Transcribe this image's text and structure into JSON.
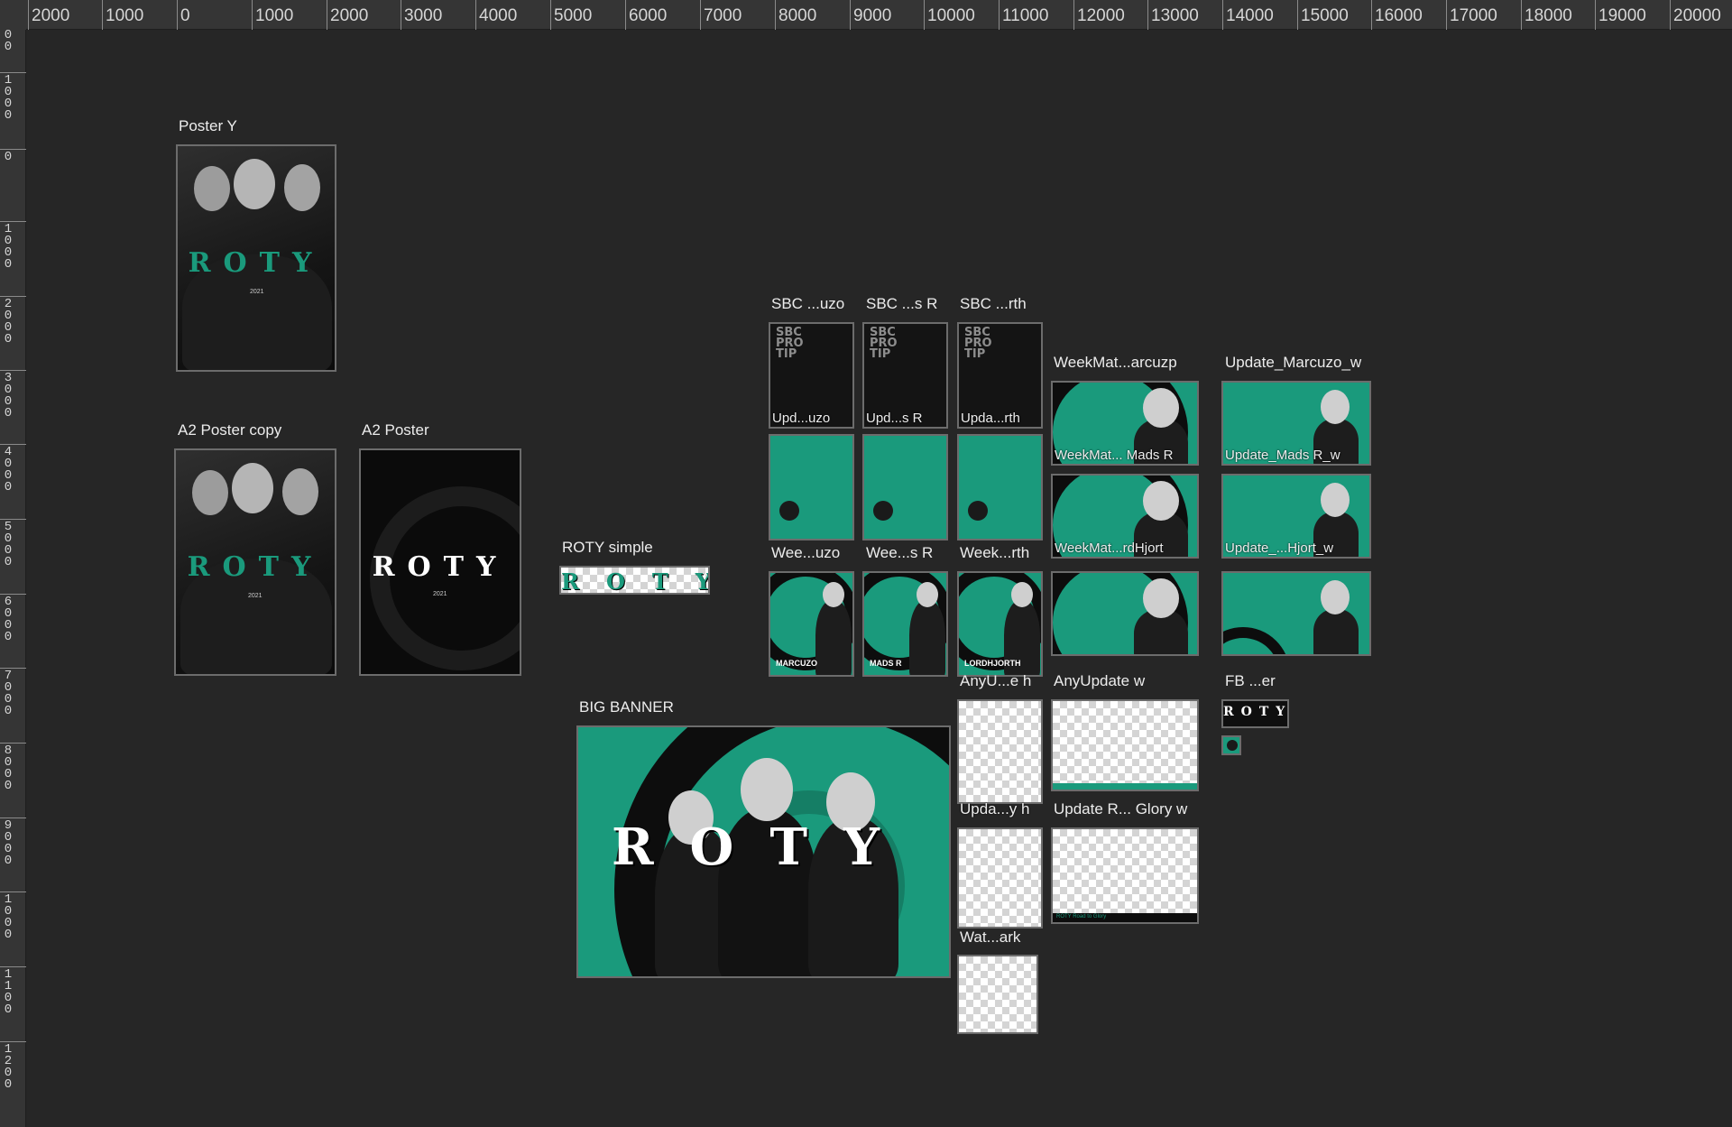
{
  "ruler": {
    "top_ticks": [
      "2000",
      "1000",
      "0",
      "1000",
      "2000",
      "3000",
      "4000",
      "5000",
      "6000",
      "7000",
      "8000",
      "9000",
      "10000",
      "11000",
      "12000",
      "13000",
      "14000",
      "15000",
      "16000",
      "17000",
      "18000",
      "19000",
      "20000"
    ],
    "left_ticks": [
      "0\n0",
      "1\n0\n0\n0",
      "0",
      "1\n0\n0\n0",
      "2\n0\n0\n0",
      "3\n0\n0\n0",
      "4\n0\n0\n0",
      "5\n0\n0\n0",
      "6\n0\n0\n0",
      "7\n0\n0\n0",
      "8\n0\n0\n0",
      "9\n0\n0\n0",
      "1\n0\n0\n0",
      "1\n1\n0\n0",
      "1\n2\n0\n0"
    ]
  },
  "artboards": {
    "poster_y": {
      "label": "Poster Y",
      "wordmark": "ROTY",
      "year": "2021"
    },
    "a2_poster_copy": {
      "label": "A2 Poster copy",
      "wordmark": "ROTY",
      "year": "2021"
    },
    "a2_poster": {
      "label": "A2 Poster",
      "wordmark": "ROTY",
      "year": "2021"
    },
    "roty_simple": {
      "label": "ROTY simple",
      "wordmark": "ROTY"
    },
    "big_banner": {
      "label": "BIG BANNER",
      "wordmark": "ROTY"
    },
    "sbc_1": {
      "label": "SBC ...uzo",
      "overlay": "Upd...uzo",
      "title": "SBC PRO TIP"
    },
    "sbc_2": {
      "label": "SBC ...s R",
      "overlay": "Upd...s R",
      "title": "SBC PRO TIP"
    },
    "sbc_3": {
      "label": "SBC ...rth",
      "overlay": "Upda...rth",
      "title": "SBC PRO TIP"
    },
    "wee_1": {
      "label": "Wee...uzo",
      "player": "MARCUZO"
    },
    "wee_2": {
      "label": "Wee...s R",
      "player": "MADS R"
    },
    "wee_3": {
      "label": "Week...rth",
      "player": "LORDHJORTH"
    },
    "weekmat_marcuzo": {
      "label": "WeekMat...arcuzp",
      "overlay": "WeekMat... Mads R"
    },
    "weekmat_2": {
      "overlay": "WeekMat...rdHjort"
    },
    "weekmat_3": {},
    "update_marcuzo": {
      "label": "Update_Marcuzo_w",
      "overlay": "Update_Mads R_w"
    },
    "update_2": {
      "overlay": "Update_...Hjort_w"
    },
    "update_3": {},
    "anyu_h": {
      "label": "AnyU...e h",
      "overlay": "Upda...y h"
    },
    "anyupdate_w": {
      "label": "AnyUpdate w"
    },
    "update_r_glory": {
      "label": "Update R... Glory w",
      "footer": "ROTY Road to Glory"
    },
    "upda_y_h": {},
    "watermark": {
      "label": "Wat...ark"
    },
    "fb_er": {
      "label": "FB ...er"
    }
  },
  "colors": {
    "canvas": "#262626",
    "ruler": "#353535",
    "teal": "#1a9a7c",
    "artboard_border": "#6c6c6c"
  }
}
